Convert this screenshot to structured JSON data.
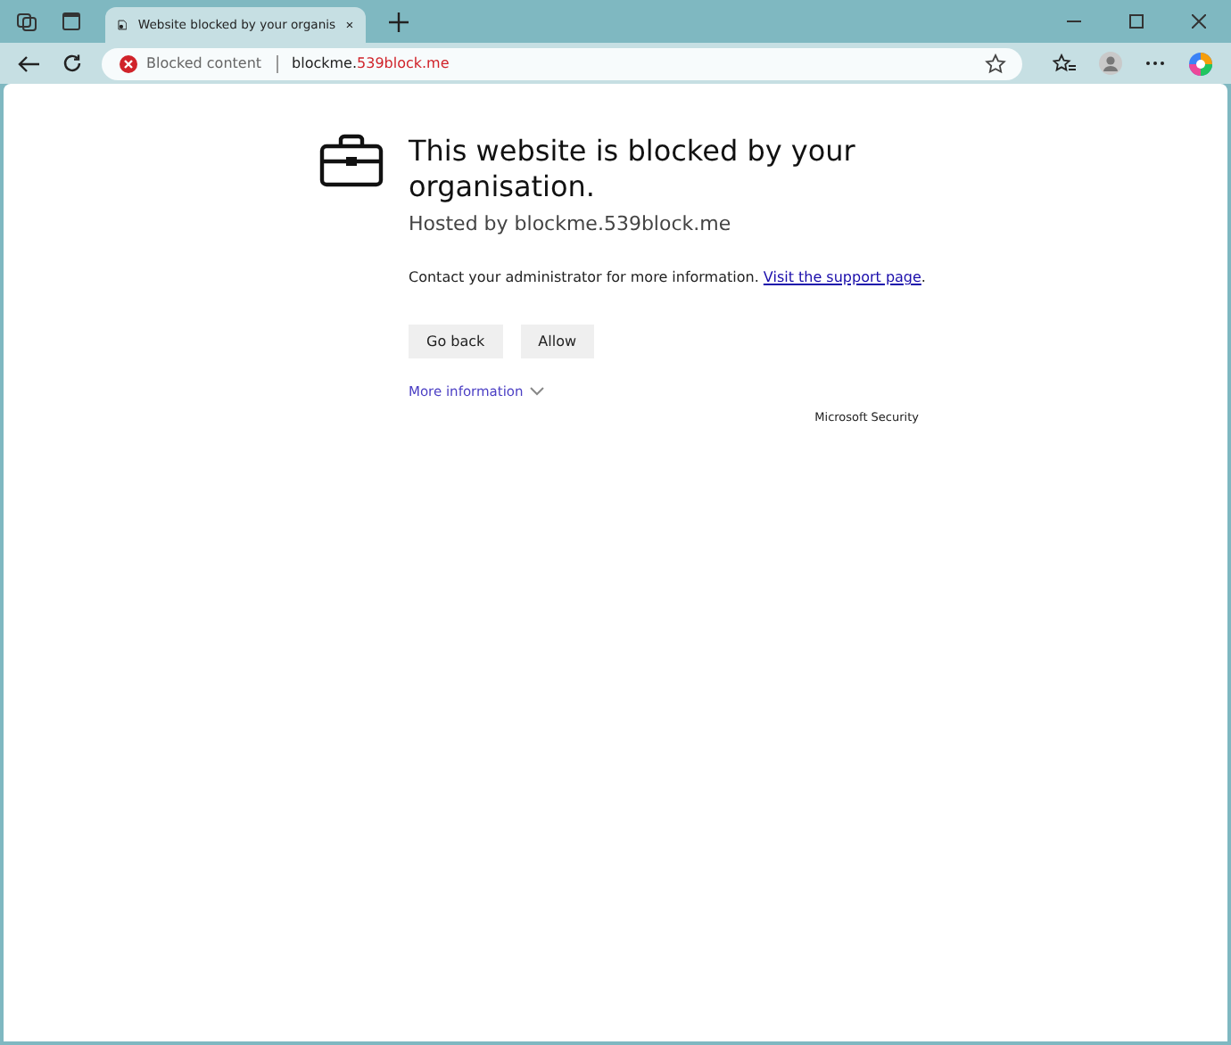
{
  "tab": {
    "title": "Website blocked by your organis",
    "selected": true
  },
  "address_bar": {
    "status": "Blocked content",
    "host_start": "blockme.",
    "host_domain": "539block.me"
  },
  "page": {
    "heading": "This website is blocked by your organisation.",
    "hosted_by": "Hosted by blockme.539block.me",
    "message": "Contact your administrator for more information.",
    "link": "Visit the support page",
    "link_end": ".",
    "buttons": [
      "Go back",
      "Allow"
    ],
    "more_info": "More information",
    "more_info_expanded": false,
    "footer": "Microsoft Security"
  }
}
